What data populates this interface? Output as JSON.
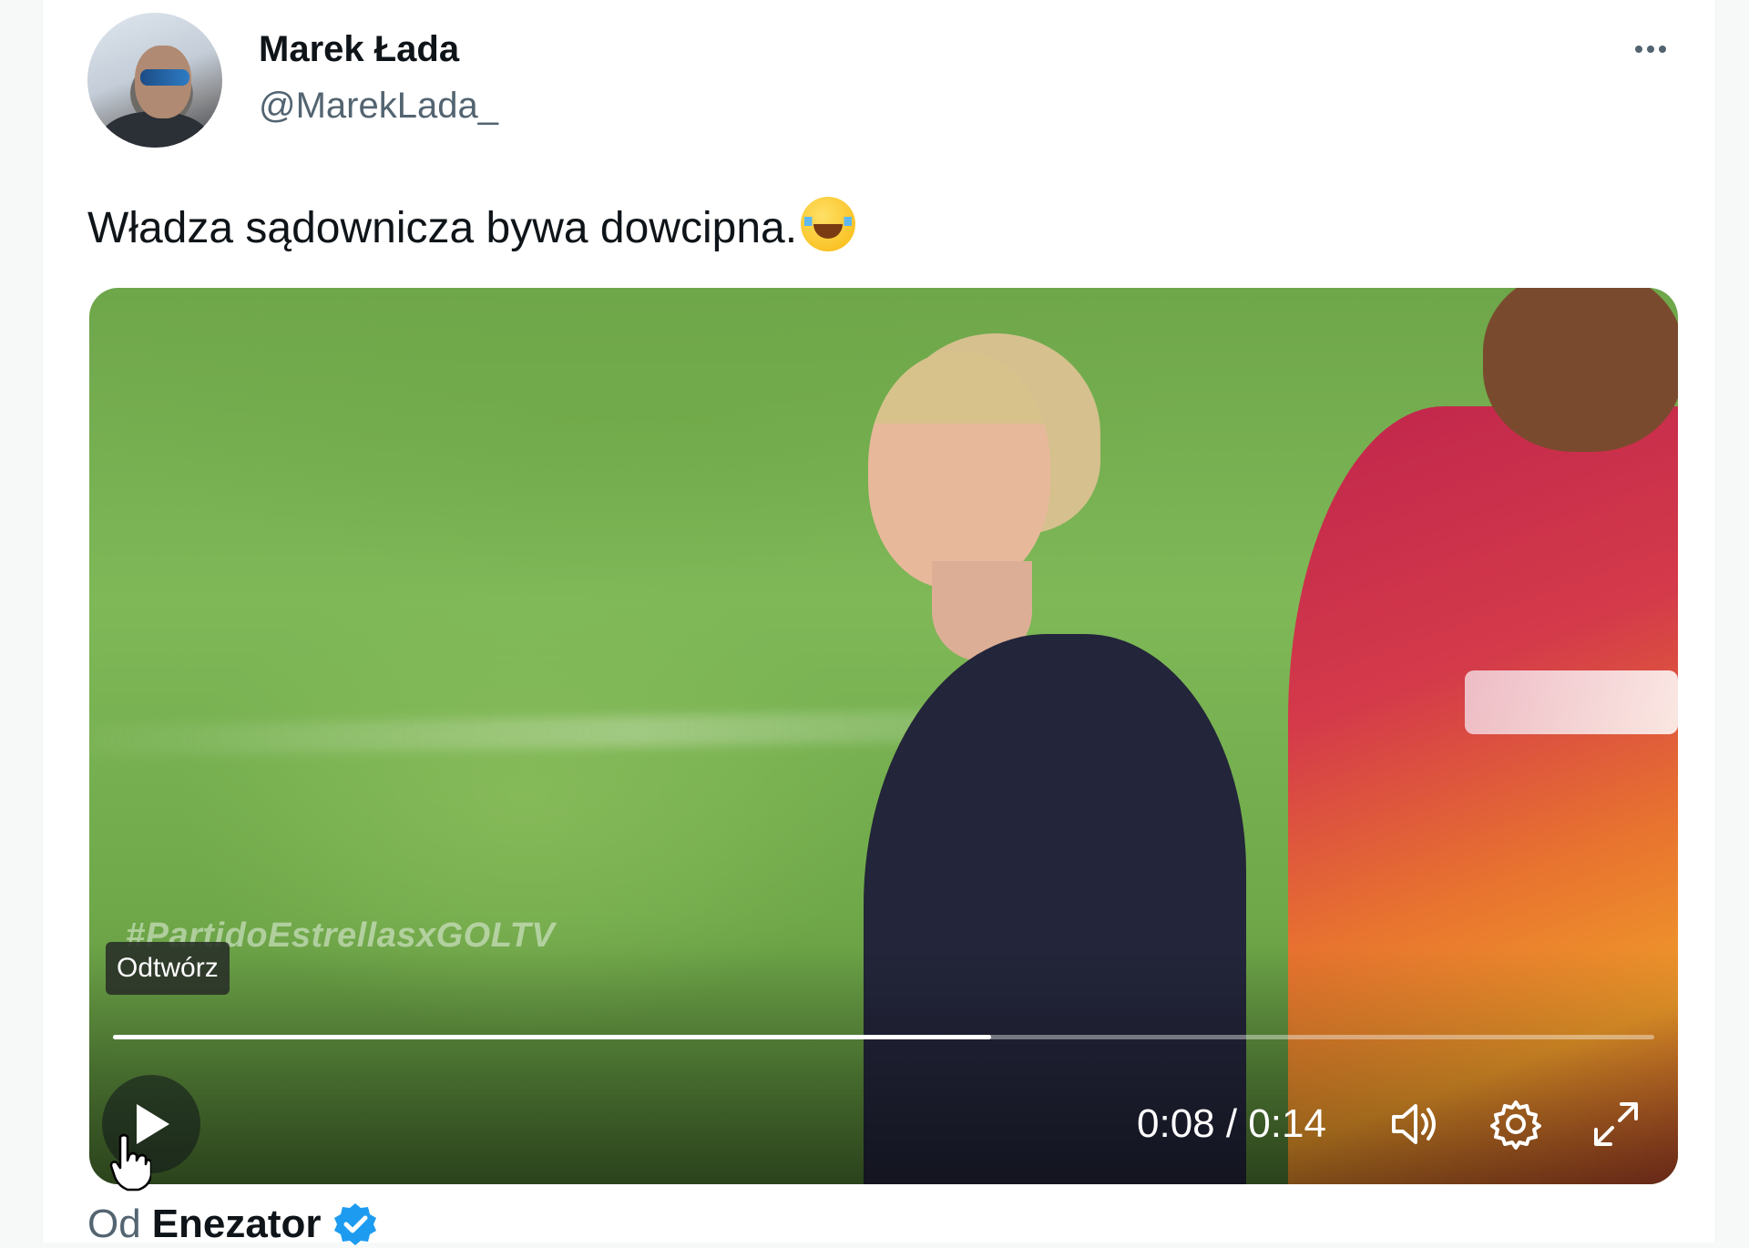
{
  "author": {
    "display_name": "Marek Łada",
    "handle": "@MarekLada_"
  },
  "tweet": {
    "text": "Władza sądownicza bywa dowcipna.",
    "emoji": "face-with-tears-of-joy"
  },
  "video": {
    "watermark": "#PartidoEstrellasxGOLTV",
    "tooltip": "Odtwórz",
    "time": "0:08 / 0:14",
    "progress": 0.57,
    "controls": [
      "play-icon",
      "volume-icon",
      "settings-icon",
      "fullscreen-icon"
    ]
  },
  "attribution": {
    "prefix": "Od",
    "source": "Enezator",
    "verified": true
  },
  "colors": {
    "text_primary": "#0f1419",
    "text_secondary": "#536471",
    "verified_badge": "#1d9bf0"
  }
}
